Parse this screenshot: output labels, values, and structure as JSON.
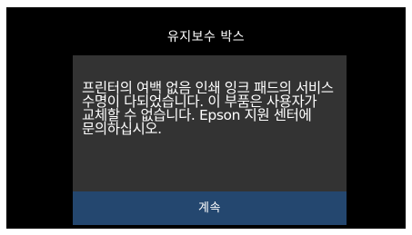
{
  "screen": {
    "title": "유지보수 박스"
  },
  "dialog": {
    "message": "프린터의 여백 없음 인쇄 잉크 패드의 서비스 수명이 다되었습니다. 이 부품은 사용자가 교체할 수 없습니다. Epson 지원 센터에 문의하십시오.",
    "continue_label": "계속"
  },
  "colors": {
    "screen_background": "#000000",
    "dialog_background": "#333333",
    "button_background": "#24476f",
    "text": "#ffffff"
  }
}
